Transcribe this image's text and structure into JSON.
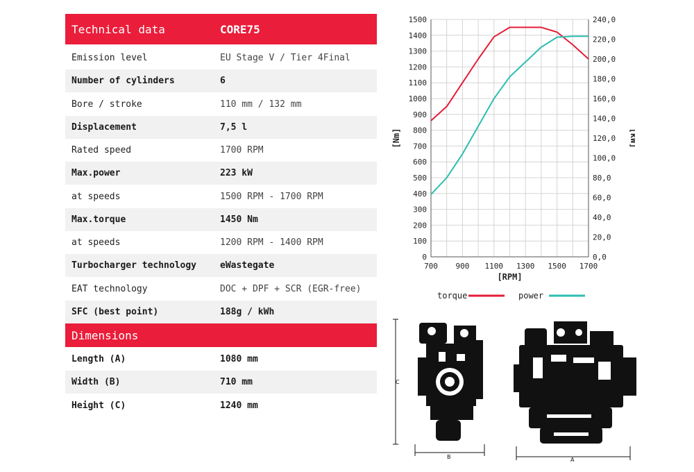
{
  "technical": {
    "title": "Technical data",
    "model": "CORE75",
    "rows": [
      {
        "label": "Emission level",
        "value": "EU Stage V / Tier 4Final",
        "bold": false
      },
      {
        "label": "Number of cylinders",
        "value": "6",
        "bold": true
      },
      {
        "label": "Bore / stroke",
        "value": "110 mm / 132 mm",
        "bold": false
      },
      {
        "label": "Displacement",
        "value": "7,5 l",
        "bold": true
      },
      {
        "label": "Rated speed",
        "value": "1700 RPM",
        "bold": false
      },
      {
        "label": "Max.power",
        "value": "223 kW",
        "bold": true
      },
      {
        "label": "at speeds",
        "value": "1500 RPM - 1700 RPM",
        "bold": false
      },
      {
        "label": "Max.torque",
        "value": "1450 Nm",
        "bold": true
      },
      {
        "label": "at speeds",
        "value": "1200 RPM - 1400 RPM",
        "bold": false
      },
      {
        "label": "Turbocharger technology",
        "value": "eWastegate",
        "bold": true
      },
      {
        "label": "EAT technology",
        "value": "DOC + DPF + SCR (EGR-free)",
        "bold": false
      },
      {
        "label": "SFC (best point)",
        "value": "188g / kWh",
        "bold": true
      }
    ]
  },
  "dimensions": {
    "title": "Dimensions",
    "rows": [
      {
        "label": "Length (A)",
        "value": "1080 mm"
      },
      {
        "label": "Width (B)",
        "value": "710 mm"
      },
      {
        "label": "Height (C)",
        "value": "1240 mm"
      }
    ]
  },
  "drawings": {
    "side_label": "B",
    "front_label": "A",
    "height_label": "C"
  },
  "chart_data": {
    "type": "line",
    "xlabel": "[RPM]",
    "ylabel": "[Nm]",
    "y2label": "[kW]",
    "x": [
      700,
      800,
      900,
      1000,
      1100,
      1200,
      1300,
      1400,
      1500,
      1600,
      1700
    ],
    "xticks": [
      "700",
      "900",
      "1100",
      "1300",
      "1500",
      "1700"
    ],
    "xlim": [
      700,
      1700
    ],
    "ylim": [
      0,
      1500
    ],
    "y2lim": [
      0,
      240
    ],
    "yticks": [
      "0",
      "100",
      "200",
      "300",
      "400",
      "500",
      "600",
      "700",
      "800",
      "900",
      "1000",
      "1100",
      "1200",
      "1300",
      "1400",
      "1500"
    ],
    "y2ticks": [
      "0,0",
      "20,0",
      "40,0",
      "60,0",
      "80,0",
      "100,0",
      "120,0",
      "140,0",
      "160,0",
      "180,0",
      "200,0",
      "220,0",
      "240,0"
    ],
    "grid": true,
    "legend_position": "bottom",
    "series": [
      {
        "name": "torque",
        "axis": "left",
        "color": "#e31e37",
        "values": [
          860,
          950,
          1100,
          1250,
          1390,
          1450,
          1450,
          1450,
          1420,
          1340,
          1250
        ]
      },
      {
        "name": "power",
        "axis": "right",
        "color": "#2dbeb0",
        "values": [
          63,
          80,
          104,
          132,
          160,
          182,
          197,
          212,
          222,
          223,
          223
        ]
      }
    ]
  }
}
